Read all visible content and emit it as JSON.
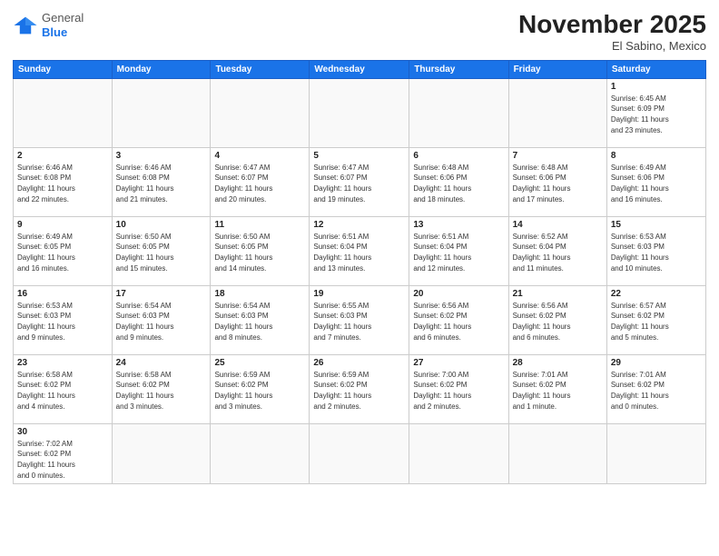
{
  "logo": {
    "general": "General",
    "blue": "Blue"
  },
  "title": "November 2025",
  "subtitle": "El Sabino, Mexico",
  "days_of_week": [
    "Sunday",
    "Monday",
    "Tuesday",
    "Wednesday",
    "Thursday",
    "Friday",
    "Saturday"
  ],
  "weeks": [
    [
      {
        "day": "",
        "info": ""
      },
      {
        "day": "",
        "info": ""
      },
      {
        "day": "",
        "info": ""
      },
      {
        "day": "",
        "info": ""
      },
      {
        "day": "",
        "info": ""
      },
      {
        "day": "",
        "info": ""
      },
      {
        "day": "1",
        "info": "Sunrise: 6:45 AM\nSunset: 6:09 PM\nDaylight: 11 hours\nand 23 minutes."
      }
    ],
    [
      {
        "day": "2",
        "info": "Sunrise: 6:46 AM\nSunset: 6:08 PM\nDaylight: 11 hours\nand 22 minutes."
      },
      {
        "day": "3",
        "info": "Sunrise: 6:46 AM\nSunset: 6:08 PM\nDaylight: 11 hours\nand 21 minutes."
      },
      {
        "day": "4",
        "info": "Sunrise: 6:47 AM\nSunset: 6:07 PM\nDaylight: 11 hours\nand 20 minutes."
      },
      {
        "day": "5",
        "info": "Sunrise: 6:47 AM\nSunset: 6:07 PM\nDaylight: 11 hours\nand 19 minutes."
      },
      {
        "day": "6",
        "info": "Sunrise: 6:48 AM\nSunset: 6:06 PM\nDaylight: 11 hours\nand 18 minutes."
      },
      {
        "day": "7",
        "info": "Sunrise: 6:48 AM\nSunset: 6:06 PM\nDaylight: 11 hours\nand 17 minutes."
      },
      {
        "day": "8",
        "info": "Sunrise: 6:49 AM\nSunset: 6:06 PM\nDaylight: 11 hours\nand 16 minutes."
      }
    ],
    [
      {
        "day": "9",
        "info": "Sunrise: 6:49 AM\nSunset: 6:05 PM\nDaylight: 11 hours\nand 16 minutes."
      },
      {
        "day": "10",
        "info": "Sunrise: 6:50 AM\nSunset: 6:05 PM\nDaylight: 11 hours\nand 15 minutes."
      },
      {
        "day": "11",
        "info": "Sunrise: 6:50 AM\nSunset: 6:05 PM\nDaylight: 11 hours\nand 14 minutes."
      },
      {
        "day": "12",
        "info": "Sunrise: 6:51 AM\nSunset: 6:04 PM\nDaylight: 11 hours\nand 13 minutes."
      },
      {
        "day": "13",
        "info": "Sunrise: 6:51 AM\nSunset: 6:04 PM\nDaylight: 11 hours\nand 12 minutes."
      },
      {
        "day": "14",
        "info": "Sunrise: 6:52 AM\nSunset: 6:04 PM\nDaylight: 11 hours\nand 11 minutes."
      },
      {
        "day": "15",
        "info": "Sunrise: 6:53 AM\nSunset: 6:03 PM\nDaylight: 11 hours\nand 10 minutes."
      }
    ],
    [
      {
        "day": "16",
        "info": "Sunrise: 6:53 AM\nSunset: 6:03 PM\nDaylight: 11 hours\nand 9 minutes."
      },
      {
        "day": "17",
        "info": "Sunrise: 6:54 AM\nSunset: 6:03 PM\nDaylight: 11 hours\nand 9 minutes."
      },
      {
        "day": "18",
        "info": "Sunrise: 6:54 AM\nSunset: 6:03 PM\nDaylight: 11 hours\nand 8 minutes."
      },
      {
        "day": "19",
        "info": "Sunrise: 6:55 AM\nSunset: 6:03 PM\nDaylight: 11 hours\nand 7 minutes."
      },
      {
        "day": "20",
        "info": "Sunrise: 6:56 AM\nSunset: 6:02 PM\nDaylight: 11 hours\nand 6 minutes."
      },
      {
        "day": "21",
        "info": "Sunrise: 6:56 AM\nSunset: 6:02 PM\nDaylight: 11 hours\nand 6 minutes."
      },
      {
        "day": "22",
        "info": "Sunrise: 6:57 AM\nSunset: 6:02 PM\nDaylight: 11 hours\nand 5 minutes."
      }
    ],
    [
      {
        "day": "23",
        "info": "Sunrise: 6:58 AM\nSunset: 6:02 PM\nDaylight: 11 hours\nand 4 minutes."
      },
      {
        "day": "24",
        "info": "Sunrise: 6:58 AM\nSunset: 6:02 PM\nDaylight: 11 hours\nand 3 minutes."
      },
      {
        "day": "25",
        "info": "Sunrise: 6:59 AM\nSunset: 6:02 PM\nDaylight: 11 hours\nand 3 minutes."
      },
      {
        "day": "26",
        "info": "Sunrise: 6:59 AM\nSunset: 6:02 PM\nDaylight: 11 hours\nand 2 minutes."
      },
      {
        "day": "27",
        "info": "Sunrise: 7:00 AM\nSunset: 6:02 PM\nDaylight: 11 hours\nand 2 minutes."
      },
      {
        "day": "28",
        "info": "Sunrise: 7:01 AM\nSunset: 6:02 PM\nDaylight: 11 hours\nand 1 minute."
      },
      {
        "day": "29",
        "info": "Sunrise: 7:01 AM\nSunset: 6:02 PM\nDaylight: 11 hours\nand 0 minutes."
      }
    ],
    [
      {
        "day": "30",
        "info": "Sunrise: 7:02 AM\nSunset: 6:02 PM\nDaylight: 11 hours\nand 0 minutes."
      },
      {
        "day": "",
        "info": ""
      },
      {
        "day": "",
        "info": ""
      },
      {
        "day": "",
        "info": ""
      },
      {
        "day": "",
        "info": ""
      },
      {
        "day": "",
        "info": ""
      },
      {
        "day": "",
        "info": ""
      }
    ]
  ]
}
